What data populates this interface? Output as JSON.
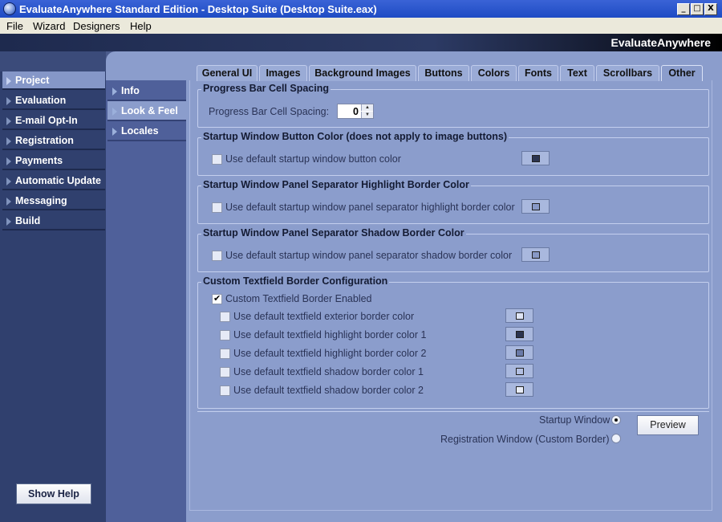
{
  "window": {
    "title": "EvaluateAnywhere Standard Edition - Desktop Suite (Desktop Suite.eax)",
    "controls": {
      "minimize": "_",
      "maximize": "□",
      "close": "X"
    }
  },
  "menu": {
    "items": [
      {
        "label": "File"
      },
      {
        "label": "Wizard"
      },
      {
        "label": "Designers"
      },
      {
        "label": "Help"
      }
    ]
  },
  "banner": {
    "brand": "EvaluateAnywhere"
  },
  "left_nav": {
    "items": [
      {
        "label": "Project",
        "active": true
      },
      {
        "label": "Evaluation"
      },
      {
        "label": "E-mail Opt-In"
      },
      {
        "label": "Registration"
      },
      {
        "label": "Payments"
      },
      {
        "label": "Automatic Update"
      },
      {
        "label": "Messaging"
      },
      {
        "label": "Build"
      }
    ],
    "show_help": "Show Help"
  },
  "sub_nav": {
    "items": [
      {
        "label": "Info"
      },
      {
        "label": "Look & Feel",
        "active": true
      },
      {
        "label": "Locales"
      }
    ]
  },
  "tabs": [
    {
      "label": "General UI"
    },
    {
      "label": "Images"
    },
    {
      "label": "Background Images"
    },
    {
      "label": "Buttons"
    },
    {
      "label": "Colors"
    },
    {
      "label": "Fonts"
    },
    {
      "label": "Text"
    },
    {
      "label": "Scrollbars"
    },
    {
      "label": "Other",
      "active": true
    }
  ],
  "groups": {
    "progress": {
      "title": "Progress Bar Cell Spacing",
      "label": "Progress Bar Cell Spacing:",
      "value": "0"
    },
    "button_color": {
      "title": "Startup Window Button Color (does not apply to image buttons)",
      "checkbox": "Use default startup window button color",
      "checked": false,
      "swatch_color": "#2b3450"
    },
    "highlight": {
      "title": "Startup Window Panel Separator Highlight Border Color",
      "checkbox": "Use default startup window panel separator highlight border color",
      "checked": false,
      "swatch_color": "#8899c6"
    },
    "shadow": {
      "title": "Startup Window Panel Separator Shadow Border Color",
      "checkbox": "Use default startup window panel separator shadow border color",
      "checked": false,
      "swatch_color": "#8899c6"
    },
    "textfield": {
      "title": "Custom Textfield Border Configuration",
      "enabled_label": "Custom Textfield Border Enabled",
      "enabled": true,
      "options": [
        {
          "label": "Use default textfield exterior border color",
          "checked": false,
          "color": "#dfe5f5"
        },
        {
          "label": "Use default textfield highlight border color 1",
          "checked": false,
          "color": "#2b3450"
        },
        {
          "label": "Use default textfield highlight border color 2",
          "checked": false,
          "color": "#6a7aa8"
        },
        {
          "label": "Use default textfield shadow border color 1",
          "checked": false,
          "color": "#b3c0e2"
        },
        {
          "label": "Use default textfield shadow border color 2",
          "checked": false,
          "color": "#e8ecf7"
        }
      ]
    }
  },
  "preview": {
    "startup_label": "Startup Window",
    "startup_selected": true,
    "registration_label": "Registration Window (Custom Border)",
    "registration_selected": false,
    "button": "Preview"
  }
}
